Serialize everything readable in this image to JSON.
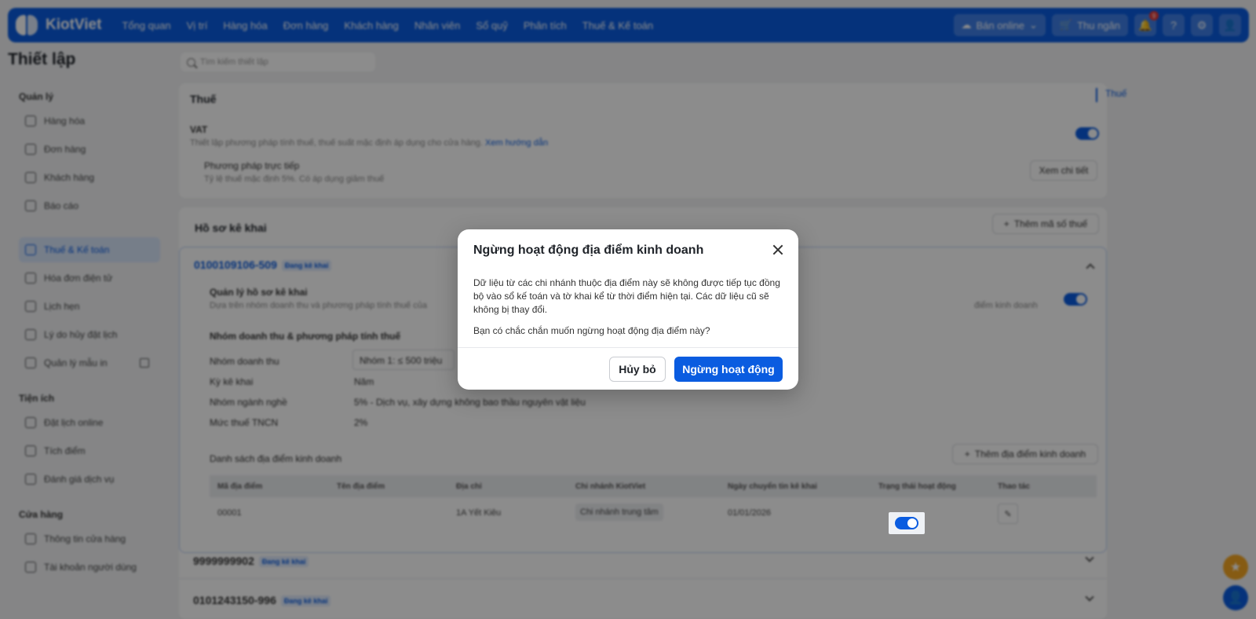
{
  "app": {
    "logo_text": "KiotViet"
  },
  "nav": [
    "Tổng quan",
    "Vị trí",
    "Hàng hóa",
    "Đơn hàng",
    "Khách hàng",
    "Nhân viên",
    "Sổ quỹ",
    "Phân tích",
    "Thuế & Kế toán"
  ],
  "topbar": {
    "online_label": "Bán online",
    "cashier_label": "Thu ngân",
    "notif_count": "9"
  },
  "page_title": "Thiết lập",
  "search": {
    "placeholder": "Tìm kiếm thiết lập"
  },
  "sidebar": {
    "sections": [
      {
        "title": "Quản lý",
        "items": [
          "Hàng hóa",
          "Đơn hàng",
          "Khách hàng",
          "Báo cáo"
        ]
      },
      {
        "title": "",
        "items": [
          "Thuế & Kế toán",
          "Hóa đơn điện tử",
          "Lịch hẹn",
          "Lý do hủy đặt lịch",
          "Quản lý mẫu in"
        ]
      },
      {
        "title": "Tiện ích",
        "items": [
          "Đặt lịch online",
          "Tích điểm",
          "Đánh giá dịch vụ"
        ]
      },
      {
        "title": "Cửa hàng",
        "items": [
          "Thông tin cửa hàng",
          "Tài khoản người dùng"
        ]
      }
    ]
  },
  "tax": {
    "title": "Thuế",
    "vat_label": "VAT",
    "vat_desc": "Thiết lập phương pháp tính thuế, thuế suất mặc định áp dụng cho cửa hàng.",
    "vat_link": "Xem hướng dẫn",
    "method_title": "Phương pháp trực tiếp",
    "method_desc": "Tỷ lệ thuế mặc định 5%. Có áp dụng giảm thuế",
    "detail_btn": "Xem chi tiết"
  },
  "profiles": {
    "title": "Hồ sơ kê khai",
    "add_btn": "Thêm mã số thuế",
    "p1": {
      "code": "0100109106-509",
      "tag": "Đang kê khai",
      "manage_title": "Quản lý hồ sơ kê khai",
      "manage_desc": "Dựa trên nhóm doanh thu và phương pháp tính thuế của",
      "manage_desc_end": "điểm kinh doanh",
      "group_title": "Nhóm doanh thu & phương pháp tính thuế",
      "fields": [
        {
          "label": "Nhóm doanh thu",
          "value": "Nhóm 1: ≤ 500 triệu"
        },
        {
          "label": "Kỳ kê khai",
          "value": "Năm"
        },
        {
          "label": "Nhóm ngành nghề",
          "value": "5% - Dịch vụ, xây dựng không bao thầu nguyên vật liệu"
        },
        {
          "label": "Mức thuế TNCN",
          "value": "2%"
        }
      ],
      "locations_title": "Danh sách địa điểm kinh doanh",
      "add_location_btn": "Thêm địa điểm kinh doanh",
      "columns": [
        "Mã địa điểm",
        "Tên địa điểm",
        "Địa chỉ",
        "Chi nhánh KiotViet",
        "Ngày chuyển tin kê khai",
        "Trạng thái hoạt động",
        "Thao tác"
      ],
      "row": {
        "code": "00001",
        "name": "",
        "address": "1A Yết Kiêu",
        "branch": "Chi nhánh trung tâm",
        "date": "01/01/2026"
      }
    },
    "p2": {
      "code": "9999999902",
      "tag": "Đang kê khai"
    },
    "p3": {
      "code": "0101243150-996",
      "tag": "Đang kê khai"
    }
  },
  "right_nav": {
    "item": "Thuế"
  },
  "modal": {
    "title": "Ngừng hoạt động địa điểm kinh doanh",
    "body": "Dữ liệu từ các chi nhánh thuộc địa điểm này sẽ không được tiếp tục đồng bộ vào sổ kế toán và tờ khai kể từ thời điểm hiện tại. Các dữ liệu cũ sẽ không bị thay đổi.",
    "question": "Bạn có chắc chắn muốn ngừng hoạt động địa điểm này?",
    "cancel": "Hủy bỏ",
    "confirm": "Ngừng hoạt động"
  },
  "colors": {
    "primary": "#0a5ce0",
    "fab_star": "#f5a623"
  }
}
